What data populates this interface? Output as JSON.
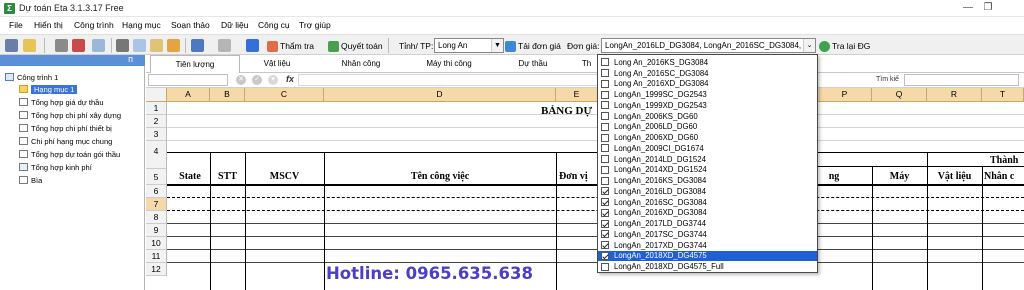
{
  "window": {
    "title": "Dự toán Eta 3.1.3.17 Free",
    "app_icon": "Σ",
    "minimize": "—",
    "restore": "❐"
  },
  "menu": [
    "File",
    "Hiển thị",
    "Công trình",
    "Hạng mục",
    "Soạn thảo",
    "Dữ liệu",
    "Công cụ",
    "Trợ giúp"
  ],
  "toolbar": {
    "tham_tra": "Thẩm tra",
    "quyet_toan": "Quyết toán",
    "tinh_tp_label": "Tỉnh/ TP:",
    "tinh_tp_value": "Long An",
    "tai_don_gia": "Tải đơn giá",
    "don_gia_label": "Đơn giá:",
    "don_gia_value": "LongAn_2016LD_DG3084, LongAn_2016SC_DG3084, Lo",
    "tra_lai": "Tra lại ĐG"
  },
  "sidebar": {
    "pin": "ᴨ",
    "items": [
      "Công trình 1",
      "Hạng mục 1",
      "Tổng hợp giá dự thầu",
      "Tổng hợp chi phí xây dựng",
      "Tổng hợp chi phí thiết bị",
      "Chi phí hạng mục chung",
      "Tổng hợp dự toán gói thầu",
      "Tổng hợp kinh phí",
      "Bìa"
    ]
  },
  "tabs": [
    "Tiên lượng",
    "Vật liệu",
    "Nhân công",
    "Máy thi công",
    "Dự thầu",
    "Th"
  ],
  "formula": {
    "fx": "fx",
    "find_label": "Tìm kiế"
  },
  "grid": {
    "columns": [
      "A",
      "B",
      "C",
      "D",
      "E",
      "P",
      "Q",
      "R",
      "T"
    ],
    "rows": [
      "1",
      "2",
      "3",
      "4",
      "5",
      "6",
      "7",
      "8",
      "9",
      "10",
      "11",
      "12"
    ],
    "title": "BẢNG DỰ",
    "headers": {
      "state": "State",
      "stt": "STT",
      "mscv": "MSCV",
      "ten_cong_viec": "Tên công việc",
      "don_vi": "Đơn vị",
      "ng": "ng",
      "may": "Máy",
      "vat_lieu": "Vật liệu",
      "nhan_cong": "Nhân c",
      "thanh": "Thành"
    }
  },
  "dropdown": {
    "items": [
      {
        "label": "Long An_2016KS_DG3084",
        "checked": false
      },
      {
        "label": "Long An_2016SC_DG3084",
        "checked": false
      },
      {
        "label": "Long An_2016XD_DG3084",
        "checked": false
      },
      {
        "label": "LongAn_1999SC_DG2543",
        "checked": false
      },
      {
        "label": "LongAn_1999XD_DG2543",
        "checked": false
      },
      {
        "label": "LongAn_2006KS_DG60",
        "checked": false
      },
      {
        "label": "LongAn_2006LD_DG60",
        "checked": false
      },
      {
        "label": "LongAn_2006XD_DG60",
        "checked": false
      },
      {
        "label": "LongAn_2009CI_DG1674",
        "checked": false
      },
      {
        "label": "LongAn_2014LD_DG1524",
        "checked": false
      },
      {
        "label": "LongAn_2014XD_DG1524",
        "checked": false
      },
      {
        "label": "LongAn_2016KS_DG3084",
        "checked": false
      },
      {
        "label": "LongAn_2016LD_DG3084",
        "checked": true
      },
      {
        "label": "LongAn_2016SC_DG3084",
        "checked": true
      },
      {
        "label": "LongAn_2016XD_DG3084",
        "checked": true
      },
      {
        "label": "LongAn_2017LD_DG3744",
        "checked": true
      },
      {
        "label": "LongAn_2017SC_DG3744",
        "checked": true
      },
      {
        "label": "LongAn_2017XD_DG3744",
        "checked": true
      },
      {
        "label": "LongAn_2018XD_DG4575",
        "checked": true,
        "selected": true
      },
      {
        "label": "LongAn_2018XD_DG4575_Full",
        "checked": false
      }
    ]
  },
  "hotline": "Hotline: 0965.635.638"
}
